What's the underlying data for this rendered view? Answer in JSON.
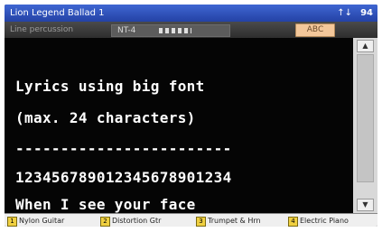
{
  "titlebar": {
    "title": "Lion Legend Ballad 1",
    "signal": "↑↓",
    "clock": "94"
  },
  "toolbar": {
    "left_label": "Line percussion",
    "field_value": "NT-4",
    "button_label": "ABC"
  },
  "lyrics": {
    "lines": [
      "Lyrics using big font",
      "(max. 24 characters)",
      "------------------------",
      "123456789012345678901234",
      "When I see your face"
    ]
  },
  "scrollbar": {
    "up": "▲",
    "down": "▼"
  },
  "bottom_bar": {
    "slots": [
      {
        "num": "1",
        "label": "Nylon Guitar"
      },
      {
        "num": "2",
        "label": "Distortion Gtr"
      },
      {
        "num": "3",
        "label": "Trumpet & Hrn"
      },
      {
        "num": "4",
        "label": "Electric Piano"
      }
    ]
  },
  "colors": {
    "title_bg": "#2f50bd",
    "lyrics_bg": "#050505",
    "lyrics_text": "#ffffff",
    "button_bg": "#f3c79a",
    "slot_badge": "#f0d040"
  }
}
